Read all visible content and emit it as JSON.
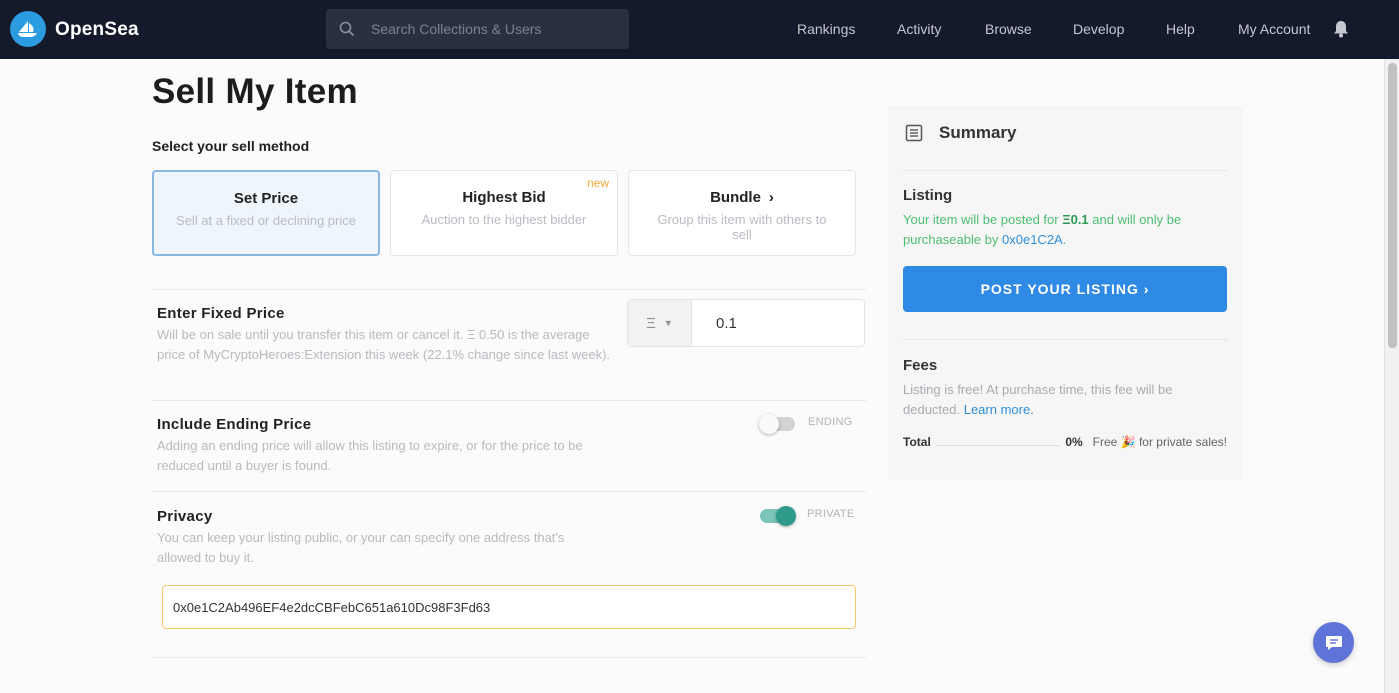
{
  "navbar": {
    "brand": "OpenSea",
    "search_placeholder": "Search Collections & Users",
    "links": [
      "Rankings",
      "Activity",
      "Browse",
      "Develop",
      "Help",
      "My Account"
    ]
  },
  "page": {
    "title": "Sell My Item",
    "method_label": "Select your sell method"
  },
  "methods": [
    {
      "title": "Set Price",
      "desc": "Sell at a fixed or declining price",
      "selected": true
    },
    {
      "title": "Highest Bid",
      "desc": "Auction to the highest bidder",
      "badge": "new"
    },
    {
      "title": "Bundle",
      "desc": "Group this item with others to sell"
    }
  ],
  "fixed_price": {
    "title": "Enter Fixed Price",
    "desc": "Will be on sale until you transfer this item or cancel it. Ξ 0.50 is the average price of MyCryptoHeroes:Extension this week (22.1% change since last week).",
    "currency": "Ξ",
    "value": "0.1"
  },
  "ending_price": {
    "title": "Include Ending Price",
    "desc": "Adding an ending price will allow this listing to expire, or for the price to be reduced until a buyer is found.",
    "toggle_label": "ENDING",
    "enabled": false
  },
  "privacy": {
    "title": "Privacy",
    "desc": "You can keep your listing public, or your can specify one address that's allowed to buy it.",
    "toggle_label": "PRIVATE",
    "enabled": true,
    "address": "0x0e1C2Ab496EF4e2dcCBFebC651a610Dc98F3Fd63"
  },
  "summary": {
    "title": "Summary",
    "listing_title": "Listing",
    "listing_pre": "Your item will be posted for ",
    "listing_price": "Ξ0.1",
    "listing_mid": " and will only be purchaseable by ",
    "listing_addr": "0x0e1C2A",
    "listing_end": ".",
    "post_button": "POST YOUR LISTING  ›",
    "fees_title": "Fees",
    "fees_text": "Listing is free! At purchase time, this fee will be deducted. ",
    "learn_more": "Learn more.",
    "total_label": "Total",
    "total_pct": "0%",
    "total_note": "Free 🎉 for private sales!"
  },
  "colors": {
    "nav_bg": "#14192b",
    "accent_blue": "#2f8ae5",
    "listing_green": "#4ebf72",
    "toggle_on": "#2e9b8a",
    "chat_bg": "#5f74d8"
  }
}
